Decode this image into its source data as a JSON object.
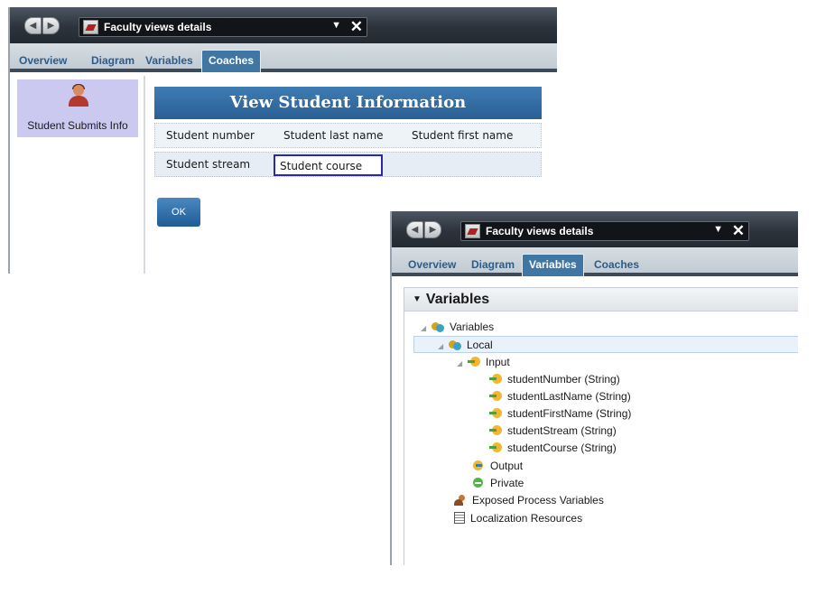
{
  "window1": {
    "title": "Faculty views details",
    "dropdown_glyph": "▼",
    "close_glyph": "✕",
    "tabs": [
      {
        "label": "Overview",
        "active": false
      },
      {
        "label": "Diagram",
        "active": false
      },
      {
        "label": "Variables",
        "active": false
      },
      {
        "label": "Coaches",
        "active": true
      }
    ],
    "activity": {
      "label": "Student Submits Info",
      "icon": "person-icon"
    },
    "coach": {
      "title": "View Student Information",
      "row1": [
        "Student number",
        "Student last name",
        "Student first name"
      ],
      "row2": [
        "Student stream",
        "Student course"
      ],
      "ok_label": "OK"
    }
  },
  "window2": {
    "title": "Faculty views details",
    "dropdown_glyph": "▼",
    "close_glyph": "✕",
    "tabs": [
      {
        "label": "Overview",
        "active": false
      },
      {
        "label": "Diagram",
        "active": false
      },
      {
        "label": "Variables",
        "active": true
      },
      {
        "label": "Coaches",
        "active": false
      }
    ],
    "pane_title": "Variables",
    "tree": [
      {
        "label": "Variables",
        "icon": "variables-icon"
      },
      {
        "label": "Local",
        "icon": "variables-icon"
      },
      {
        "label": "Input",
        "icon": "input-arrow-icon"
      },
      {
        "label": "studentNumber (String)",
        "icon": "input-arrow-icon"
      },
      {
        "label": "studentLastName (String)",
        "icon": "input-arrow-icon"
      },
      {
        "label": "studentFirstName (String)",
        "icon": "input-arrow-icon"
      },
      {
        "label": "studentStream (String)",
        "icon": "input-arrow-icon"
      },
      {
        "label": "studentCourse (String)",
        "icon": "input-arrow-icon"
      },
      {
        "label": "Output",
        "icon": "output-icon"
      },
      {
        "label": "Private",
        "icon": "private-icon"
      },
      {
        "label": "Exposed Process Variables",
        "icon": "exposed-variables-icon"
      },
      {
        "label": "Localization Resources",
        "icon": "localization-icon"
      }
    ]
  },
  "colors": {
    "titlebar": "#2c333c",
    "active_tab": "#3f76a3",
    "tab_text": "#2d5b8a",
    "coach_header": "#2a5f93",
    "activity_bg": "#cbc9ef",
    "selected_field_border": "#2828b8"
  }
}
